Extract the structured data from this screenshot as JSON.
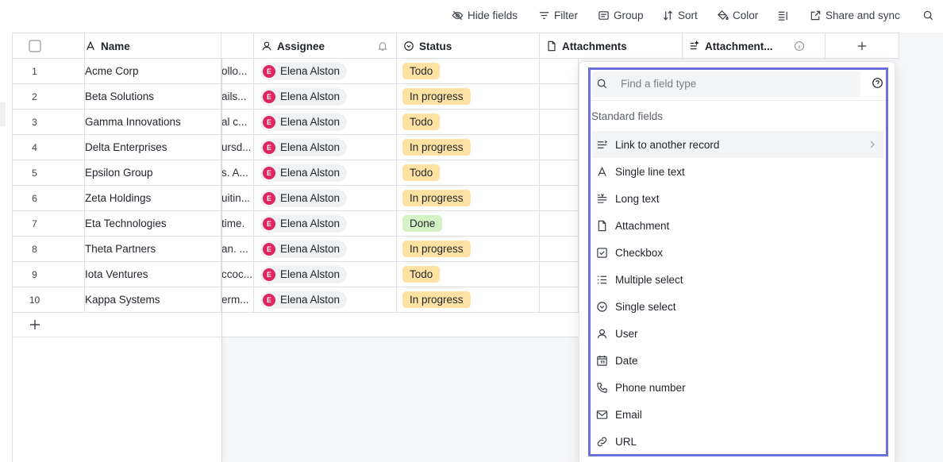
{
  "toolbar": {
    "hide_fields": "Hide fields",
    "filter": "Filter",
    "group": "Group",
    "sort": "Sort",
    "color": "Color",
    "share": "Share and sync"
  },
  "columns": {
    "name": "Name",
    "assignee": "Assignee",
    "status": "Status",
    "attachments": "Attachments",
    "attachment2": "Attachment..."
  },
  "rows": [
    {
      "num": "1",
      "name": "Acme Corp",
      "desc": "ollo...",
      "assignee": "Elena Alston",
      "initial": "E",
      "status": "Todo"
    },
    {
      "num": "2",
      "name": "Beta Solutions",
      "desc": "ails...",
      "assignee": "Elena Alston",
      "initial": "E",
      "status": "In progress"
    },
    {
      "num": "3",
      "name": "Gamma Innovations",
      "desc": "al c...",
      "assignee": "Elena Alston",
      "initial": "E",
      "status": "Todo"
    },
    {
      "num": "4",
      "name": "Delta Enterprises",
      "desc": "ursd...",
      "assignee": "Elena Alston",
      "initial": "E",
      "status": "In progress"
    },
    {
      "num": "5",
      "name": "Epsilon Group",
      "desc": "s. A...",
      "assignee": "Elena Alston",
      "initial": "E",
      "status": "Todo"
    },
    {
      "num": "6",
      "name": "Zeta Holdings",
      "desc": "uitin...",
      "assignee": "Elena Alston",
      "initial": "E",
      "status": "In progress"
    },
    {
      "num": "7",
      "name": "Eta Technologies",
      "desc": "time.",
      "assignee": "Elena Alston",
      "initial": "E",
      "status": "Done"
    },
    {
      "num": "8",
      "name": "Theta Partners",
      "desc": "an. ...",
      "assignee": "Elena Alston",
      "initial": "E",
      "status": "In progress"
    },
    {
      "num": "9",
      "name": "Iota Ventures",
      "desc": "ccoc...",
      "assignee": "Elena Alston",
      "initial": "E",
      "status": "Todo"
    },
    {
      "num": "10",
      "name": "Kappa Systems",
      "desc": "erm...",
      "assignee": "Elena Alston",
      "initial": "E",
      "status": "In progress"
    }
  ],
  "status_colors": {
    "Todo": "#fde2a3",
    "In progress": "#fde2a3",
    "Done": "#d3f3c4"
  },
  "avatar_color": "#e0245e",
  "accent_border": "#6b6fd8",
  "panel": {
    "search_placeholder": "Find a field type",
    "section": "Standard fields",
    "items": [
      {
        "label": "Link to another record",
        "icon": "link-record-icon"
      },
      {
        "label": "Single line text",
        "icon": "text-a-icon"
      },
      {
        "label": "Long text",
        "icon": "long-text-icon"
      },
      {
        "label": "Attachment",
        "icon": "file-icon"
      },
      {
        "label": "Checkbox",
        "icon": "checkbox-icon"
      },
      {
        "label": "Multiple select",
        "icon": "multi-select-icon"
      },
      {
        "label": "Single select",
        "icon": "single-select-icon"
      },
      {
        "label": "User",
        "icon": "user-icon"
      },
      {
        "label": "Date",
        "icon": "calendar-icon"
      },
      {
        "label": "Phone number",
        "icon": "phone-icon"
      },
      {
        "label": "Email",
        "icon": "email-icon"
      },
      {
        "label": "URL",
        "icon": "link-icon"
      }
    ]
  }
}
